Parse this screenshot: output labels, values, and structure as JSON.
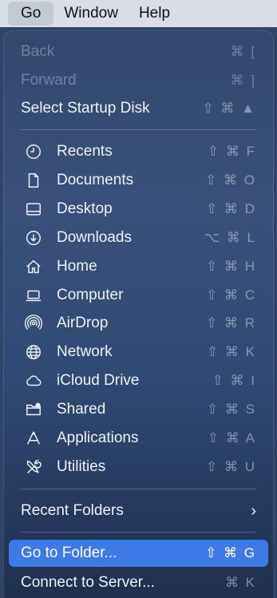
{
  "menubar": {
    "items": [
      {
        "label": "Go"
      },
      {
        "label": "Window"
      },
      {
        "label": "Help"
      }
    ]
  },
  "menu": {
    "back": {
      "label": "Back",
      "shortcut": "⌘ ["
    },
    "forward": {
      "label": "Forward",
      "shortcut": "⌘ ]"
    },
    "startup": {
      "label": "Select Startup Disk",
      "shortcut": "⇧ ⌘ ▲"
    },
    "places": [
      {
        "label": "Recents",
        "shortcut": "⇧ ⌘ F",
        "icon": "clock-icon"
      },
      {
        "label": "Documents",
        "shortcut": "⇧ ⌘ O",
        "icon": "document-icon"
      },
      {
        "label": "Desktop",
        "shortcut": "⇧ ⌘ D",
        "icon": "desktop-icon"
      },
      {
        "label": "Downloads",
        "shortcut": "⌥ ⌘ L",
        "icon": "download-icon"
      },
      {
        "label": "Home",
        "shortcut": "⇧ ⌘ H",
        "icon": "home-icon"
      },
      {
        "label": "Computer",
        "shortcut": "⇧ ⌘ C",
        "icon": "laptop-icon"
      },
      {
        "label": "AirDrop",
        "shortcut": "⇧ ⌘ R",
        "icon": "airdrop-icon"
      },
      {
        "label": "Network",
        "shortcut": "⇧ ⌘ K",
        "icon": "globe-icon"
      },
      {
        "label": "iCloud Drive",
        "shortcut": "⇧ ⌘ I",
        "icon": "cloud-icon"
      },
      {
        "label": "Shared",
        "shortcut": "⇧ ⌘ S",
        "icon": "shared-folder-icon"
      },
      {
        "label": "Applications",
        "shortcut": "⇧ ⌘ A",
        "icon": "applications-icon"
      },
      {
        "label": "Utilities",
        "shortcut": "⇧ ⌘ U",
        "icon": "tools-icon"
      }
    ],
    "recent_folders": {
      "label": "Recent Folders",
      "chevron": "›"
    },
    "go_to_folder": {
      "label": "Go to Folder...",
      "shortcut": "⇧ ⌘ G"
    },
    "connect_server": {
      "label": "Connect to Server...",
      "shortcut": "⌘ K"
    }
  },
  "colors": {
    "highlight": "#3d7ae6",
    "menubar": "#d8dde6"
  }
}
